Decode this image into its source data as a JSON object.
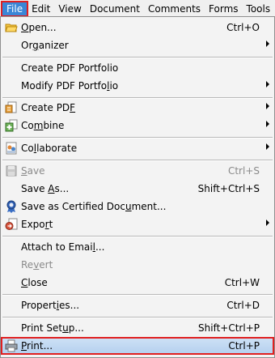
{
  "menubar": {
    "items": [
      "File",
      "Edit",
      "View",
      "Document",
      "Comments",
      "Forms",
      "Tools"
    ]
  },
  "menu": {
    "open": {
      "pre": "",
      "u": "O",
      "post": "pen...",
      "shortcut": "Ctrl+O"
    },
    "organizer": {
      "pre": "Or",
      "u": "g",
      "post": "anizer"
    },
    "create_portfolio": {
      "label": "Create PDF Portfolio"
    },
    "modify_portfolio": {
      "pre": "Modify PDF Portfo",
      "u": "l",
      "post": "io"
    },
    "create_pdf": {
      "pre": "Create PD",
      "u": "F",
      "post": ""
    },
    "combine": {
      "pre": "Co",
      "u": "m",
      "post": "bine"
    },
    "collaborate": {
      "pre": "Co",
      "u": "l",
      "post": "laborate"
    },
    "save": {
      "pre": "",
      "u": "S",
      "post": "ave",
      "shortcut": "Ctrl+S"
    },
    "save_as": {
      "pre": "Save ",
      "u": "A",
      "post": "s...",
      "shortcut": "Shift+Ctrl+S"
    },
    "save_certified": {
      "pre": "Save as Certified Doc",
      "u": "u",
      "post": "ment..."
    },
    "export": {
      "pre": "Expo",
      "u": "r",
      "post": "t"
    },
    "attach_email": {
      "pre": "Attach to Emai",
      "u": "l",
      "post": "..."
    },
    "revert": {
      "pre": "Re",
      "u": "v",
      "post": "ert"
    },
    "close": {
      "pre": "",
      "u": "C",
      "post": "lose",
      "shortcut": "Ctrl+W"
    },
    "properties": {
      "pre": "Propert",
      "u": "i",
      "post": "es...",
      "shortcut": "Ctrl+D"
    },
    "print_setup": {
      "pre": "Print Set",
      "u": "u",
      "post": "p...",
      "shortcut": "Shift+Ctrl+P"
    },
    "print": {
      "pre": "",
      "u": "P",
      "post": "rint...",
      "shortcut": "Ctrl+P"
    }
  }
}
